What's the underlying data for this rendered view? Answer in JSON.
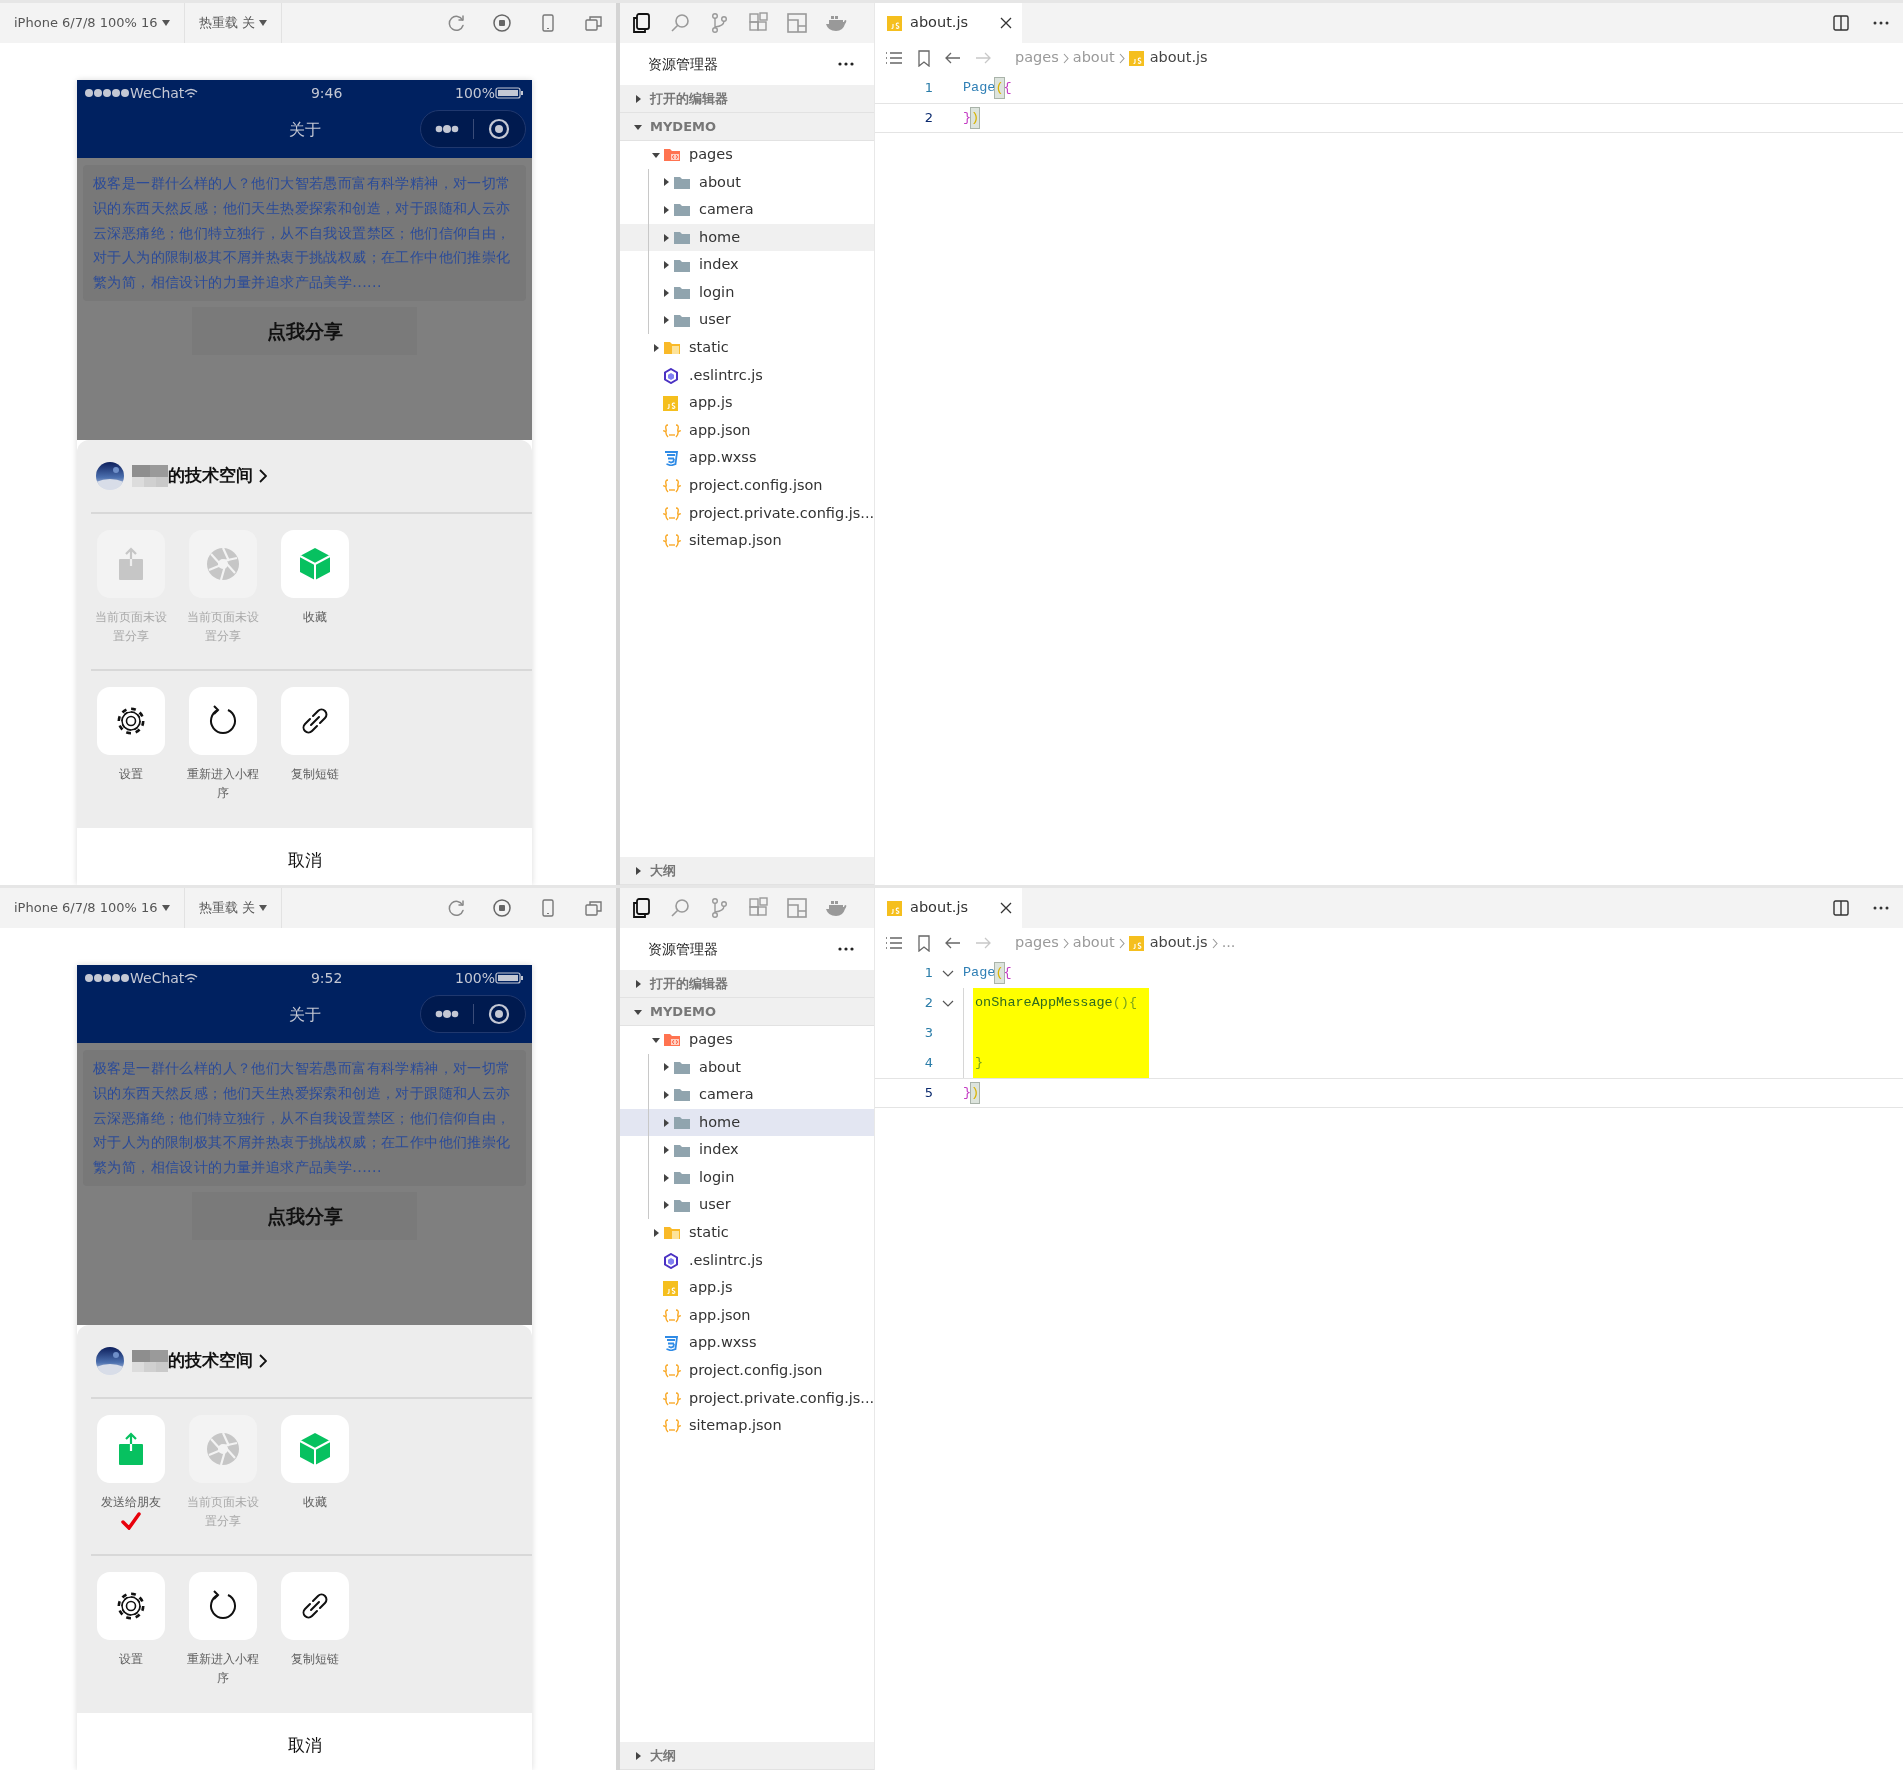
{
  "panels": [
    {
      "simulator": {
        "device": "iPhone 6/7/8 100% 16",
        "hot_reload": "热重载 关",
        "phone": {
          "carrier": "WeChat",
          "time": "9:46",
          "battery": "100%",
          "title": "关于",
          "paragraph": "极客是一群什么样的人？他们大智若愚而富有科学精神，对一切常识的东西天然反感；他们天生热爱探索和创造，对于跟随和人云亦云深恶痛绝；他们特立独行，从不自我设置禁区；他们信仰自由，对于人为的限制极其不屑并热衷于挑战权威；在工作中他们推崇化繁为简，相信设计的力量并追求产品美学......",
          "share_button": "点我分享",
          "sheet": {
            "account": "的技术空间",
            "share_actions": [
              {
                "kind": "share",
                "label": "当前页面未设置分享",
                "enabled": false,
                "marked": false
              },
              {
                "kind": "moments",
                "label": "当前页面未设置分享",
                "enabled": false,
                "marked": false
              },
              {
                "kind": "favorite",
                "label": "收藏",
                "enabled": true,
                "marked": false
              }
            ],
            "other_actions": [
              {
                "kind": "settings",
                "label": "设置"
              },
              {
                "kind": "restart",
                "label": "重新进入小程序"
              },
              {
                "kind": "link",
                "label": "复制短链"
              }
            ],
            "cancel": "取消"
          }
        }
      },
      "explorer": {
        "title": "资源管理器",
        "sections": [
          {
            "label": "打开的编辑器",
            "expanded": false
          },
          {
            "label": "MYDEMO",
            "expanded": true
          }
        ],
        "tree": [
          {
            "label": "pages",
            "kind": "pages-folder",
            "expanded": true,
            "selected": false,
            "hovered": false,
            "children": [
              {
                "label": "about",
                "kind": "folder",
                "expanded": false,
                "selected": false,
                "hovered": false
              },
              {
                "label": "camera",
                "kind": "folder",
                "expanded": false,
                "selected": false,
                "hovered": false
              },
              {
                "label": "home",
                "kind": "folder",
                "expanded": false,
                "selected": false,
                "hovered": true
              },
              {
                "label": "index",
                "kind": "folder",
                "expanded": false,
                "selected": false,
                "hovered": false
              },
              {
                "label": "login",
                "kind": "folder",
                "expanded": false,
                "selected": false,
                "hovered": false
              },
              {
                "label": "user",
                "kind": "folder",
                "expanded": false,
                "selected": false,
                "hovered": false
              }
            ]
          },
          {
            "label": "static",
            "kind": "static-folder",
            "expanded": false,
            "selected": false,
            "hovered": false
          },
          {
            "label": ".eslintrc.js",
            "kind": "eslint",
            "selected": false,
            "hovered": false
          },
          {
            "label": "app.js",
            "kind": "js",
            "selected": false,
            "hovered": false
          },
          {
            "label": "app.json",
            "kind": "json",
            "selected": false,
            "hovered": false
          },
          {
            "label": "app.wxss",
            "kind": "css",
            "selected": false,
            "hovered": false
          },
          {
            "label": "project.config.json",
            "kind": "json",
            "selected": false,
            "hovered": false
          },
          {
            "label": "project.private.config.js...",
            "kind": "json",
            "selected": false,
            "hovered": false
          },
          {
            "label": "sitemap.json",
            "kind": "json",
            "selected": false,
            "hovered": false
          }
        ],
        "outline": {
          "label": "大纲",
          "expanded": false
        }
      },
      "editor": {
        "tab": "about.js",
        "breadcrumb": [
          {
            "text": "pages",
            "kind": "folder"
          },
          {
            "text": "about",
            "kind": "folder"
          },
          {
            "text": "about.js",
            "kind": "js"
          }
        ],
        "lines": [
          {
            "number": "1",
            "kind": "top",
            "foldable": false,
            "highlighted": false,
            "current": false,
            "tokens": [
              {
                "text": "Page",
                "kind": "identifier",
                "matched": false
              },
              {
                "text": "(",
                "kind": "bracket-1",
                "matched": true
              },
              {
                "text": "{",
                "kind": "bracket-2",
                "matched": false
              }
            ]
          },
          {
            "number": "2",
            "kind": "top",
            "foldable": false,
            "highlighted": false,
            "current": true,
            "tokens": [
              {
                "text": "}",
                "kind": "bracket-2",
                "matched": false
              },
              {
                "text": ")",
                "kind": "bracket-1",
                "matched": true
              }
            ]
          }
        ]
      }
    },
    {
      "simulator": {
        "device": "iPhone 6/7/8 100% 16",
        "hot_reload": "热重载 关",
        "phone": {
          "carrier": "WeChat",
          "time": "9:52",
          "battery": "100%",
          "title": "关于",
          "paragraph": "极客是一群什么样的人？他们大智若愚而富有科学精神，对一切常识的东西天然反感；他们天生热爱探索和创造，对于跟随和人云亦云深恶痛绝；他们特立独行，从不自我设置禁区；他们信仰自由，对于人为的限制极其不屑并热衷于挑战权威；在工作中他们推崇化繁为简，相信设计的力量并追求产品美学......",
          "share_button": "点我分享",
          "sheet": {
            "account": "的技术空间",
            "share_actions": [
              {
                "kind": "share",
                "label": "发送给朋友",
                "enabled": true,
                "marked": true
              },
              {
                "kind": "moments",
                "label": "当前页面未设置分享",
                "enabled": false,
                "marked": false
              },
              {
                "kind": "favorite",
                "label": "收藏",
                "enabled": true,
                "marked": false
              }
            ],
            "other_actions": [
              {
                "kind": "settings",
                "label": "设置"
              },
              {
                "kind": "restart",
                "label": "重新进入小程序"
              },
              {
                "kind": "link",
                "label": "复制短链"
              }
            ],
            "cancel": "取消"
          }
        }
      },
      "explorer": {
        "title": "资源管理器",
        "sections": [
          {
            "label": "打开的编辑器",
            "expanded": false
          },
          {
            "label": "MYDEMO",
            "expanded": true
          }
        ],
        "tree": [
          {
            "label": "pages",
            "kind": "pages-folder",
            "expanded": true,
            "selected": false,
            "hovered": false,
            "children": [
              {
                "label": "about",
                "kind": "folder",
                "expanded": false,
                "selected": false,
                "hovered": false
              },
              {
                "label": "camera",
                "kind": "folder",
                "expanded": false,
                "selected": false,
                "hovered": false
              },
              {
                "label": "home",
                "kind": "folder",
                "expanded": false,
                "selected": true,
                "hovered": false
              },
              {
                "label": "index",
                "kind": "folder",
                "expanded": false,
                "selected": false,
                "hovered": false
              },
              {
                "label": "login",
                "kind": "folder",
                "expanded": false,
                "selected": false,
                "hovered": false
              },
              {
                "label": "user",
                "kind": "folder",
                "expanded": false,
                "selected": false,
                "hovered": false
              }
            ]
          },
          {
            "label": "static",
            "kind": "static-folder",
            "expanded": false,
            "selected": false,
            "hovered": false
          },
          {
            "label": ".eslintrc.js",
            "kind": "eslint",
            "selected": false,
            "hovered": false
          },
          {
            "label": "app.js",
            "kind": "js",
            "selected": false,
            "hovered": false
          },
          {
            "label": "app.json",
            "kind": "json",
            "selected": false,
            "hovered": false
          },
          {
            "label": "app.wxss",
            "kind": "css",
            "selected": false,
            "hovered": false
          },
          {
            "label": "project.config.json",
            "kind": "json",
            "selected": false,
            "hovered": false
          },
          {
            "label": "project.private.config.js...",
            "kind": "json",
            "selected": false,
            "hovered": false
          },
          {
            "label": "sitemap.json",
            "kind": "json",
            "selected": false,
            "hovered": false
          }
        ],
        "outline": {
          "label": "大纲",
          "expanded": false
        }
      },
      "editor": {
        "tab": "about.js",
        "breadcrumb": [
          {
            "text": "pages",
            "kind": "folder"
          },
          {
            "text": "about",
            "kind": "folder"
          },
          {
            "text": "about.js",
            "kind": "js"
          },
          {
            "text": "...",
            "kind": "more"
          }
        ],
        "lines": [
          {
            "number": "1",
            "kind": "top",
            "foldable": true,
            "highlighted": false,
            "current": false,
            "tokens": [
              {
                "text": "Page",
                "kind": "identifier",
                "matched": false
              },
              {
                "text": "(",
                "kind": "bracket-1",
                "matched": true
              },
              {
                "text": "{",
                "kind": "bracket-2",
                "matched": false
              }
            ]
          },
          {
            "number": "2",
            "kind": "body",
            "foldable": true,
            "highlighted": true,
            "current": false,
            "tokens": [
              {
                "text": "onShareAppMessage",
                "kind": "method",
                "matched": false
              },
              {
                "text": "()",
                "kind": "bracket-3",
                "matched": false
              },
              {
                "text": "{",
                "kind": "bracket-3",
                "matched": false
              }
            ]
          },
          {
            "number": "3",
            "kind": "body",
            "foldable": false,
            "highlighted": true,
            "current": false
          },
          {
            "number": "4",
            "kind": "body",
            "foldable": false,
            "highlighted": true,
            "current": false,
            "tokens": [
              {
                "text": "}",
                "kind": "bracket-3",
                "matched": false
              }
            ]
          },
          {
            "number": "5",
            "kind": "top",
            "foldable": false,
            "highlighted": false,
            "current": true,
            "tokens": [
              {
                "text": "}",
                "kind": "bracket-2",
                "matched": false
              },
              {
                "text": ")",
                "kind": "bracket-1",
                "matched": true
              }
            ]
          }
        ]
      }
    }
  ]
}
